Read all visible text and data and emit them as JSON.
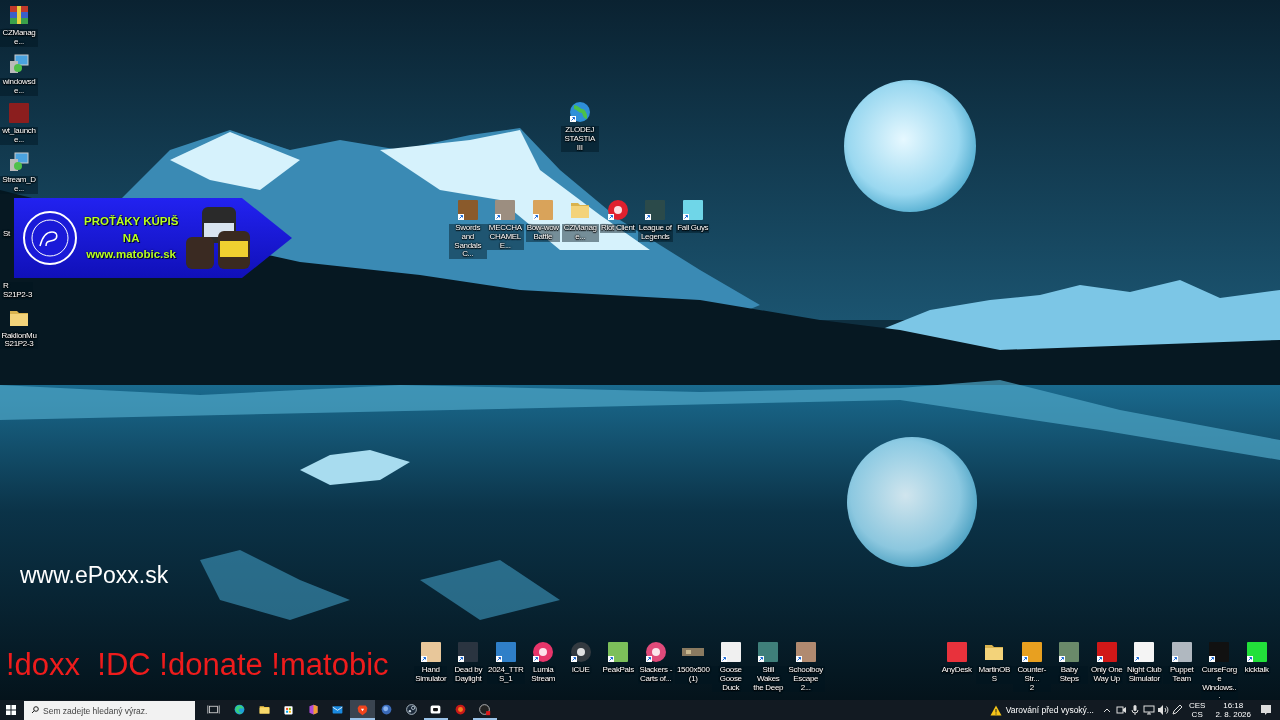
{
  "desktop": {
    "left_column": [
      {
        "lines": [
          "CZManage..."
        ],
        "kind": "archive",
        "color": "#c0392b",
        "shortcut": false
      },
      {
        "lines": [
          "windowsde..."
        ],
        "kind": "installer",
        "color": "#4aa3df",
        "shortcut": false
      },
      {
        "lines": [
          "wt_launche..."
        ],
        "kind": "app",
        "color": "#8b1e1e",
        "shortcut": false
      },
      {
        "lines": [
          "Stream_De..."
        ],
        "kind": "installer",
        "color": "#4aa3df",
        "shortcut": false
      },
      {
        "lines": [
          "St"
        ],
        "kind": "covered"
      },
      {
        "lines": [
          "R",
          "S21P2-3"
        ],
        "kind": "covered"
      },
      {
        "lines": [
          "RaklionMu",
          "S21P2-3"
        ],
        "kind": "folder",
        "color": "#f3d37a",
        "shortcut": false
      }
    ],
    "top_icon": {
      "lines": [
        "ZLODEJ",
        "STASTIA III"
      ],
      "kind": "globe",
      "color": "#2f8fd8",
      "shortcut": true
    },
    "top_row": [
      {
        "lines": [
          "Swords and",
          "Sandals C..."
        ],
        "kind": "app",
        "color": "#8a5a2b",
        "shortcut": true
      },
      {
        "lines": [
          "MECCHA",
          "CHAMELE..."
        ],
        "kind": "app",
        "color": "#9c8e80",
        "shortcut": true
      },
      {
        "lines": [
          "Bow-wow",
          "Battle"
        ],
        "kind": "app",
        "color": "#d9a35a",
        "shortcut": true
      },
      {
        "lines": [
          "CZManage..."
        ],
        "kind": "folder",
        "color": "#f3d37a",
        "shortcut": false
      },
      {
        "lines": [
          "Riot Client"
        ],
        "kind": "round",
        "color": "#e0202e",
        "shortcut": true
      },
      {
        "lines": [
          "League of",
          "Legends"
        ],
        "kind": "app",
        "color": "#2b4a4a",
        "shortcut": true
      },
      {
        "lines": [
          "Fall Guys"
        ],
        "kind": "app",
        "color": "#6fd6e8",
        "shortcut": true
      }
    ],
    "bottom_left_row": [
      {
        "lines": [
          "Hand",
          "Simulator"
        ],
        "kind": "app",
        "color": "#e8c79a",
        "shortcut": true
      },
      {
        "lines": [
          "Dead by",
          "Daylight"
        ],
        "kind": "app",
        "color": "#2a3440",
        "shortcut": true
      },
      {
        "lines": [
          "2024_TTRS_1"
        ],
        "kind": "app",
        "color": "#2f7fc8",
        "shortcut": true
      },
      {
        "lines": [
          "Lumia",
          "Stream"
        ],
        "kind": "round",
        "color": "#e8356a",
        "shortcut": true
      },
      {
        "lines": [
          "iCUE"
        ],
        "kind": "round",
        "color": "#333a40",
        "shortcut": true
      },
      {
        "lines": [
          "PeakPals"
        ],
        "kind": "app",
        "color": "#7cbf5a",
        "shortcut": true
      },
      {
        "lines": [
          "Slackers -",
          "Carts of..."
        ],
        "kind": "round",
        "color": "#e04a7a",
        "shortcut": true
      },
      {
        "lines": [
          "1500x500 (1)"
        ],
        "kind": "image",
        "color": "#8a7a60",
        "shortcut": false
      },
      {
        "lines": [
          "Goose Goose",
          "Duck"
        ],
        "kind": "app",
        "color": "#f0f0f0",
        "shortcut": true
      },
      {
        "lines": [
          "Still Wakes",
          "the Deep"
        ],
        "kind": "app",
        "color": "#3f7f7a",
        "shortcut": true
      },
      {
        "lines": [
          "Schoolboy",
          "Escape 2..."
        ],
        "kind": "app",
        "color": "#b08a70",
        "shortcut": true
      }
    ],
    "bottom_right_row": [
      {
        "lines": [
          "AnyDesk"
        ],
        "kind": "app",
        "color": "#e8323c",
        "shortcut": false
      },
      {
        "lines": [
          "MartinOBS"
        ],
        "kind": "folder",
        "color": "#f3d37a",
        "shortcut": false
      },
      {
        "lines": [
          "Counter-Str...",
          "2"
        ],
        "kind": "app",
        "color": "#e8a020",
        "shortcut": true
      },
      {
        "lines": [
          "Baby Steps"
        ],
        "kind": "app",
        "color": "#6a8a6a",
        "shortcut": true
      },
      {
        "lines": [
          "Only One",
          "Way Up"
        ],
        "kind": "app",
        "color": "#d01818",
        "shortcut": true
      },
      {
        "lines": [
          "Night Club",
          "Simulator"
        ],
        "kind": "app",
        "color": "#f4f4f4",
        "shortcut": true
      },
      {
        "lines": [
          "Puppet Team"
        ],
        "kind": "app",
        "color": "#b0b8c0",
        "shortcut": true
      },
      {
        "lines": [
          "CurseForge",
          "Windows..."
        ],
        "kind": "app",
        "color": "#111111",
        "shortcut": true
      },
      {
        "lines": [
          "kicktalk"
        ],
        "kind": "app",
        "color": "#22e03a",
        "shortcut": true
      }
    ]
  },
  "promo_banner": {
    "headline": "PROŤÁKY KÚPIŠ",
    "middle": "NA",
    "url": "www.matobic.sk"
  },
  "stream_overlay": {
    "website": "www.ePoxx.sk",
    "commands": "!doxx  !DC !donate !matobic"
  },
  "taskbar": {
    "search": {
      "placeholder": "Sem zadejte hledaný výraz."
    },
    "apps": [
      {
        "kind": "edge",
        "selected": false,
        "running": false
      },
      {
        "kind": "explorer",
        "selected": false,
        "running": false
      },
      {
        "kind": "store",
        "selected": false,
        "running": false
      },
      {
        "kind": "office",
        "selected": false,
        "running": false
      },
      {
        "kind": "mail",
        "selected": false,
        "running": false
      },
      {
        "kind": "brave",
        "selected": true,
        "running": true
      },
      {
        "kind": "orb",
        "selected": false,
        "running": false
      },
      {
        "kind": "steam",
        "selected": false,
        "running": false
      },
      {
        "kind": "camera",
        "selected": false,
        "running": true
      },
      {
        "kind": "red",
        "selected": false,
        "running": false
      },
      {
        "kind": "record",
        "selected": false,
        "running": true
      }
    ],
    "warning": "Varování před vysoký...",
    "tray": {
      "language": "CES",
      "layout": "CS",
      "time": "16:18",
      "date": "2. 8. 2026"
    }
  }
}
